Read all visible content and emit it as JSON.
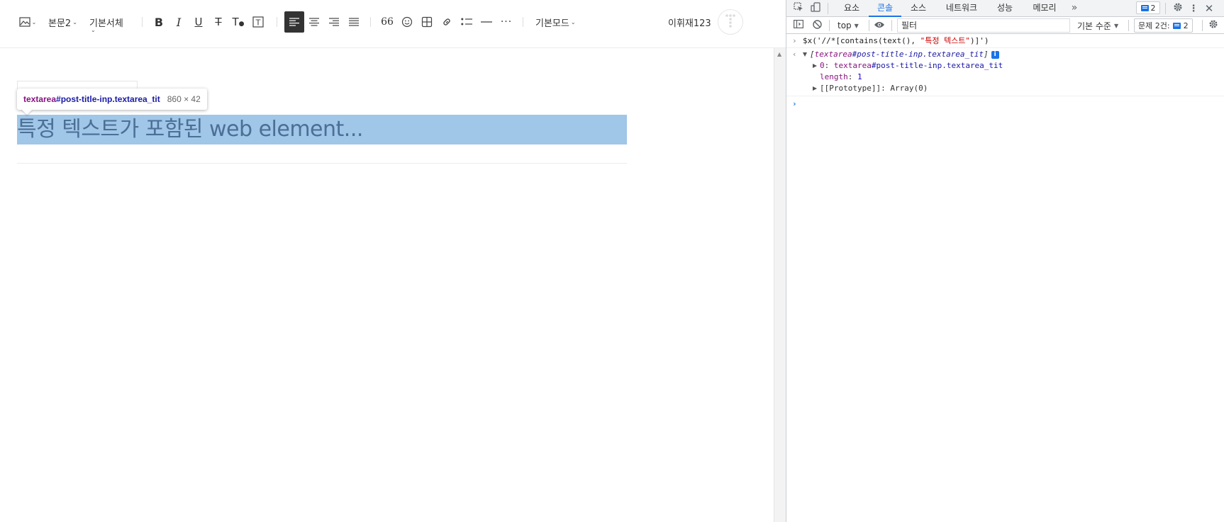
{
  "editor": {
    "toolbar": {
      "paragraph_style": "본문2",
      "font_family": "기본서체",
      "mode": "기본모드",
      "quote_glyph": "66"
    },
    "user_name": "이휘재123",
    "tooltip": {
      "tag": "textarea",
      "id": "#post-title-inp",
      "class": ".textarea_tit",
      "size": "860 × 42"
    },
    "title_text": "특정 텍스트가 포함된 web element..."
  },
  "devtools": {
    "tabs": [
      {
        "label": "요소"
      },
      {
        "label": "콘솔",
        "selected": true
      },
      {
        "label": "소스"
      },
      {
        "label": "네트워크"
      },
      {
        "label": "성능"
      },
      {
        "label": "메모리"
      }
    ],
    "more_tabs": "»",
    "messages_badge": "2",
    "toolbar": {
      "context": "top",
      "filter_placeholder": "필터",
      "level": "기본 수준",
      "issues_label": "문제 2건:",
      "issues_count": "2"
    },
    "console": {
      "command_prefix": "$x('//*[contains(text(), ",
      "command_string": "\"특정 텍스트\"",
      "command_suffix": ")]')",
      "result_tag": "textarea",
      "result_id": "#post-title-inp",
      "result_class": ".textarea_tit",
      "item0_index": "0",
      "length_label": "length",
      "length_value": "1",
      "prototype_label": "[[Prototype]]",
      "prototype_value": "Array(0)"
    }
  }
}
